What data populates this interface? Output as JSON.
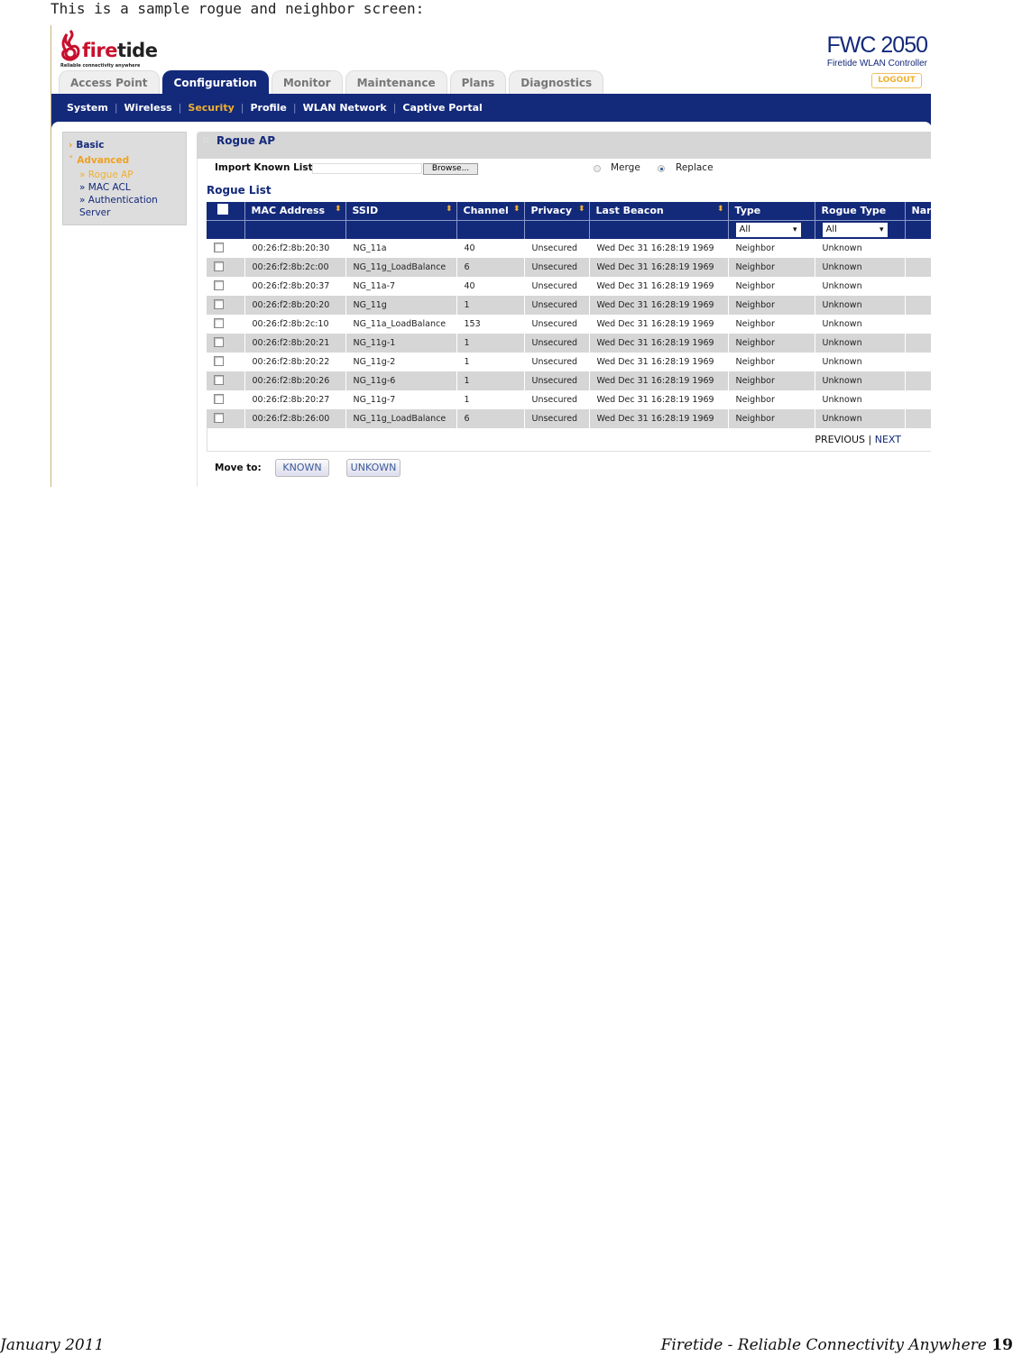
{
  "caption": "This is a sample rogue and neighbor screen:",
  "logo": {
    "word_a": "fire",
    "word_b": "tide",
    "tagline": "Reliable connectivity anywhere"
  },
  "brand": {
    "model": "FWC 2050",
    "subtitle": "Firetide WLAN Controller",
    "logout": "LOGOUT"
  },
  "tabs": [
    {
      "label": "Access Point"
    },
    {
      "label": "Configuration",
      "active": true
    },
    {
      "label": "Monitor"
    },
    {
      "label": "Maintenance"
    },
    {
      "label": "Plans"
    },
    {
      "label": "Diagnostics"
    }
  ],
  "subnav": [
    "System",
    "Wireless",
    "Security",
    "Profile",
    "WLAN Network",
    "Captive Portal"
  ],
  "sidebar": {
    "basic": "Basic",
    "advanced": "Advanced",
    "items": [
      "» Rogue AP",
      "» MAC ACL",
      "» Authentication Server"
    ]
  },
  "panel": {
    "title": "Rogue AP",
    "import_label": "Import Known List",
    "browse": "Browse...",
    "merge": "Merge",
    "replace": "Replace",
    "list_title": "Rogue List"
  },
  "table": {
    "headers": [
      "MAC Address",
      "SSID",
      "Channel",
      "Privacy",
      "Last Beacon",
      "Type",
      "Rogue Type",
      "Nar"
    ],
    "type_filter": "All",
    "rogue_type_filter": "All",
    "rows": [
      [
        "00:26:f2:8b:20:30",
        "NG_11a",
        "40",
        "Unsecured",
        "Wed Dec 31 16:28:19 1969",
        "Neighbor",
        "Unknown"
      ],
      [
        "00:26:f2:8b:2c:00",
        "NG_11g_LoadBalance",
        "6",
        "Unsecured",
        "Wed Dec 31 16:28:19 1969",
        "Neighbor",
        "Unknown"
      ],
      [
        "00:26:f2:8b:20:37",
        "NG_11a-7",
        "40",
        "Unsecured",
        "Wed Dec 31 16:28:19 1969",
        "Neighbor",
        "Unknown"
      ],
      [
        "00:26:f2:8b:20:20",
        "NG_11g",
        "1",
        "Unsecured",
        "Wed Dec 31 16:28:19 1969",
        "Neighbor",
        "Unknown"
      ],
      [
        "00:26:f2:8b:2c:10",
        "NG_11a_LoadBalance",
        "153",
        "Unsecured",
        "Wed Dec 31 16:28:19 1969",
        "Neighbor",
        "Unknown"
      ],
      [
        "00:26:f2:8b:20:21",
        "NG_11g-1",
        "1",
        "Unsecured",
        "Wed Dec 31 16:28:19 1969",
        "Neighbor",
        "Unknown"
      ],
      [
        "00:26:f2:8b:20:22",
        "NG_11g-2",
        "1",
        "Unsecured",
        "Wed Dec 31 16:28:19 1969",
        "Neighbor",
        "Unknown"
      ],
      [
        "00:26:f2:8b:20:26",
        "NG_11g-6",
        "1",
        "Unsecured",
        "Wed Dec 31 16:28:19 1969",
        "Neighbor",
        "Unknown"
      ],
      [
        "00:26:f2:8b:20:27",
        "NG_11g-7",
        "1",
        "Unsecured",
        "Wed Dec 31 16:28:19 1969",
        "Neighbor",
        "Unknown"
      ],
      [
        "00:26:f2:8b:26:00",
        "NG_11g_LoadBalance",
        "6",
        "Unsecured",
        "Wed Dec 31 16:28:19 1969",
        "Neighbor",
        "Unknown"
      ]
    ]
  },
  "pager": {
    "previous": "PREVIOUS",
    "sep": "|",
    "next": "NEXT"
  },
  "move": {
    "label": "Move to:",
    "known": "KNOWN",
    "unknown": "UNKOWN"
  },
  "footer": {
    "left": "January 2011",
    "right": "Firetide - Reliable Connectivity Anywhere",
    "page": "19"
  },
  "colors": {
    "navy": "#13297a",
    "accent": "#f0b030",
    "brand_red": "#c8102e"
  }
}
